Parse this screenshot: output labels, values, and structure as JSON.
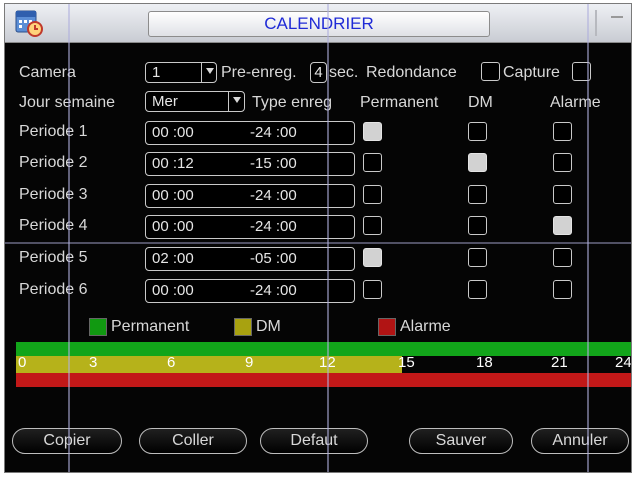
{
  "window": {
    "title": "CALENDRIER",
    "icon": "calendar-clock-icon"
  },
  "top_row": {
    "camera_label": "Camera",
    "camera_value": "1",
    "pre_enreg_label": "Pre-enreg.",
    "pre_enreg_value": "4",
    "sec_label": "sec.",
    "redondance_label": "Redondance",
    "redondance_checked": false,
    "capture_label": "Capture",
    "capture_checked": false
  },
  "header_row": {
    "jour_semaine_label": "Jour semaine",
    "jour_semaine_value": "Mer",
    "type_enreg_label": "Type enreg",
    "col_permanent": "Permanent",
    "col_dm": "DM",
    "col_alarme": "Alarme"
  },
  "periods": [
    {
      "label": "Periode 1",
      "start": "00 :00",
      "end": "-24 :00",
      "permanent": true,
      "dm": false,
      "alarme": false
    },
    {
      "label": "Periode 2",
      "start": "00 :12",
      "end": "-15 :00",
      "permanent": false,
      "dm": true,
      "alarme": false
    },
    {
      "label": "Periode 3",
      "start": "00 :00",
      "end": "-24 :00",
      "permanent": false,
      "dm": false,
      "alarme": false
    },
    {
      "label": "Periode 4",
      "start": "00 :00",
      "end": "-24 :00",
      "permanent": false,
      "dm": false,
      "alarme": true
    },
    {
      "label": "Periode 5",
      "start": "02 :00",
      "end": "-05 :00",
      "permanent": true,
      "dm": false,
      "alarme": false
    },
    {
      "label": "Periode 6",
      "start": "00 :00",
      "end": "-24 :00",
      "permanent": false,
      "dm": false,
      "alarme": false
    }
  ],
  "legend": {
    "permanent": {
      "label": "Permanent",
      "color": "#119911"
    },
    "dm": {
      "label": "DM",
      "color": "#a8a210"
    },
    "alarme": {
      "label": "Alarme",
      "color": "#b11414"
    }
  },
  "timeline": {
    "ticks": [
      "0",
      "3",
      "6",
      "9",
      "12",
      "15",
      "18",
      "21",
      "24"
    ],
    "bands": [
      {
        "type": "permanent",
        "color": "#12a51a",
        "start": 0,
        "end": 24
      },
      {
        "type": "dm",
        "color": "#b6b21a",
        "start": 0,
        "end": 15
      },
      {
        "type": "alarme",
        "color": "#c21818",
        "start": 0,
        "end": 24
      }
    ]
  },
  "buttons": {
    "copier": "Copier",
    "coller": "Coller",
    "defaut": "Defaut",
    "sauver": "Sauver",
    "annuler": "Annuler"
  }
}
